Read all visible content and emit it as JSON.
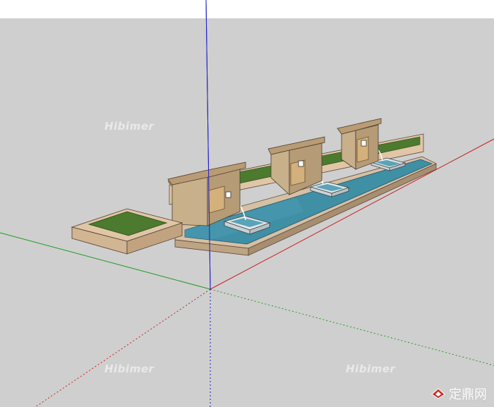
{
  "colors": {
    "sky": "#ffffff",
    "ground": "#cfcfcf",
    "axis_red": "#cc1f1f",
    "axis_green": "#1f9a1f",
    "axis_blue": "#1f1fcc",
    "wall_stone": "#c7b08a",
    "wall_cap": "#b99b74",
    "water": "#3f8fa5",
    "planter_base": "#e0c6a6",
    "grass": "#4c7a2e"
  },
  "watermarks": [
    "Hibimer",
    "Hibimer",
    "Hibimer"
  ],
  "brand": {
    "logo_icon": "brand-logo-icon",
    "text": "定鼎网"
  }
}
